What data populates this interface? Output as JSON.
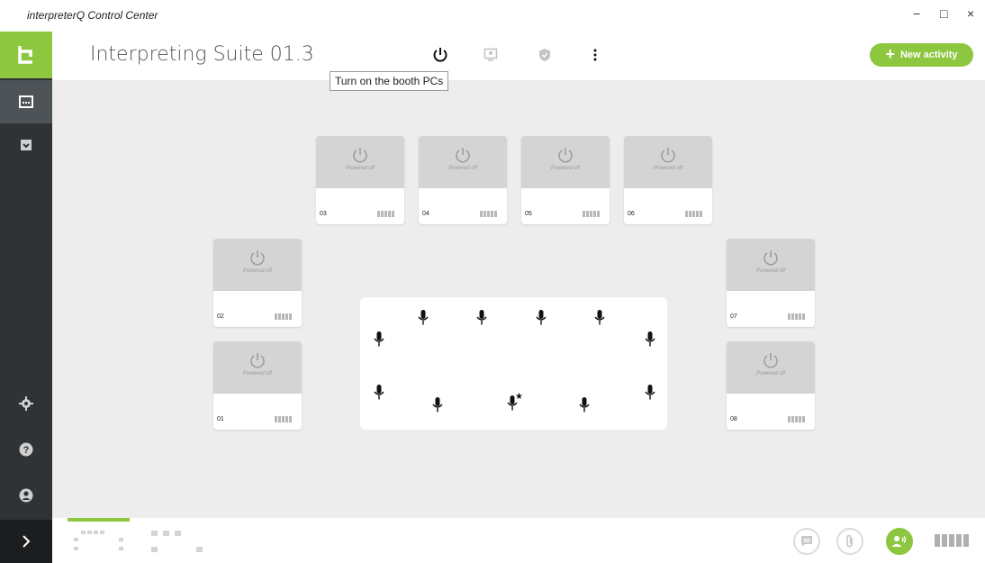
{
  "window": {
    "title": "interpreterQ Control Center",
    "controls": {
      "minimize": "−",
      "maximize": "□",
      "close": "×"
    }
  },
  "header": {
    "title": "Interpreting Suite 01.3",
    "icons": [
      "power-icon",
      "monitor-icon",
      "shield-icon",
      "more-vert-icon"
    ],
    "new_activity_label": "New activity",
    "tooltip": "Turn on the booth PCs"
  },
  "sidebar": {
    "items": [
      {
        "name": "console-icon",
        "active": true
      },
      {
        "name": "archive-icon",
        "active": false
      }
    ],
    "bottom_items": [
      "gear-icon",
      "help-icon",
      "user-icon"
    ],
    "expand_icon": "chevron-right-icon"
  },
  "booths": [
    {
      "number": "03",
      "status": "Powered off"
    },
    {
      "number": "04",
      "status": "Powered off"
    },
    {
      "number": "05",
      "status": "Powered off"
    },
    {
      "number": "06",
      "status": "Powered off"
    },
    {
      "number": "02",
      "status": "Powered off"
    },
    {
      "number": "01",
      "status": "Powered off"
    },
    {
      "number": "07",
      "status": "Powered off"
    },
    {
      "number": "08",
      "status": "Powered off"
    }
  ],
  "room": {
    "microphones": 12,
    "chair_mic_marker": "★"
  },
  "bottom": {
    "tabs": [
      "layout-view-tab",
      "grid-view-tab"
    ],
    "buttons": [
      "chat-icon",
      "attachment-icon",
      "audience-icon"
    ]
  },
  "colors": {
    "accent": "#8dc63f",
    "sidebar": "#2f3336",
    "canvas": "#ededed",
    "booth_off": "#d4d4d4"
  }
}
